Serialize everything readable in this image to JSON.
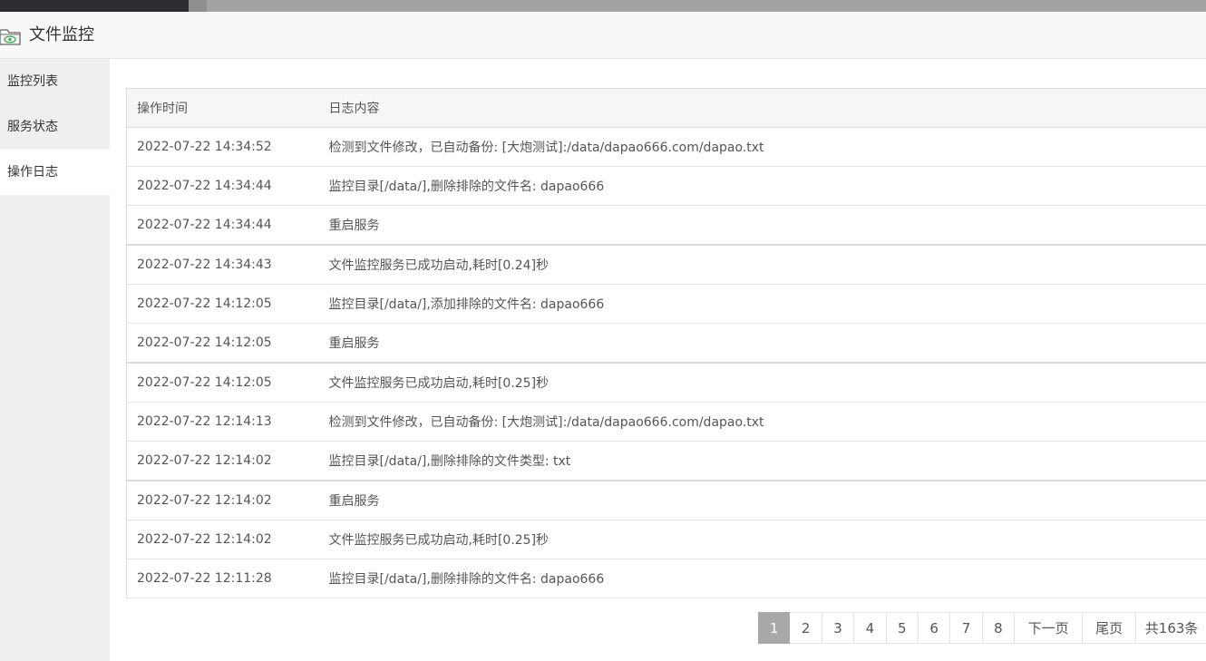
{
  "window": {
    "title": "文件监控",
    "icon": "eye-folder-icon"
  },
  "sidebar": {
    "items": [
      {
        "label": "监控列表",
        "active": false
      },
      {
        "label": "服务状态",
        "active": false
      },
      {
        "label": "操作日志",
        "active": true
      }
    ]
  },
  "table": {
    "columns": [
      "操作时间",
      "日志内容"
    ],
    "rows": [
      {
        "time": "2022-07-22 14:34:52",
        "content": "检测到文件修改，已自动备份: [大炮测试]:/data/dapao666.com/dapao.txt"
      },
      {
        "time": "2022-07-22 14:34:44",
        "content": "监控目录[/data/],删除排除的文件名: dapao666"
      },
      {
        "time": "2022-07-22 14:34:44",
        "content": "重启服务"
      },
      {
        "time": "2022-07-22 14:34:43",
        "content": "文件监控服务已成功启动,耗时[0.24]秒"
      },
      {
        "time": "2022-07-22 14:12:05",
        "content": "监控目录[/data/],添加排除的文件名: dapao666"
      },
      {
        "time": "2022-07-22 14:12:05",
        "content": "重启服务"
      },
      {
        "time": "2022-07-22 14:12:05",
        "content": "文件监控服务已成功启动,耗时[0.25]秒"
      },
      {
        "time": "2022-07-22 12:14:13",
        "content": "检测到文件修改，已自动备份: [大炮测试]:/data/dapao666.com/dapao.txt"
      },
      {
        "time": "2022-07-22 12:14:02",
        "content": "监控目录[/data/],删除排除的文件类型: txt"
      },
      {
        "time": "2022-07-22 12:14:02",
        "content": "重启服务"
      },
      {
        "time": "2022-07-22 12:14:02",
        "content": "文件监控服务已成功启动,耗时[0.25]秒"
      },
      {
        "time": "2022-07-22 12:11:28",
        "content": "监控目录[/data/],删除排除的文件名: dapao666"
      }
    ]
  },
  "pagination": {
    "pages": [
      "1",
      "2",
      "3",
      "4",
      "5",
      "6",
      "7",
      "8"
    ],
    "current": "1",
    "next_label": "下一页",
    "last_label": "尾页",
    "total_label": "共163条"
  },
  "colors": {
    "active_page": "#a8a8a8",
    "sidebar_bg": "#efefef",
    "header_bg": "#f8f8f8",
    "icon_green": "#3aa655"
  }
}
